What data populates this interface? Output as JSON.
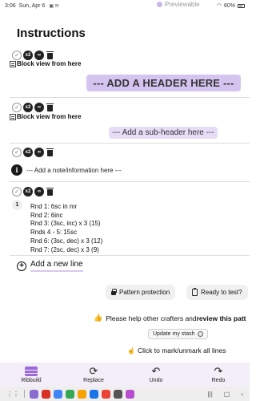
{
  "status_bar": {
    "time": "3:06",
    "date": "Sun, Apr 6",
    "battery": "60%"
  },
  "preview_link": "Previewable",
  "page_title": "Instructions",
  "blocks": [
    {
      "block_view": "Block view from here",
      "header": "--- ADD A HEADER HERE ---"
    },
    {
      "block_view": "Block view from here",
      "subheader": "--- Add a sub-header here ---"
    },
    {
      "note": "--- Add a note/information here ---"
    },
    {
      "row_number": "1",
      "rows": [
        "Rnd 1: 6sc in mr",
        "Rnd 2: 6inc",
        "Rnd 3: (3sc, inc) x 3 (15)",
        "Rnds 4 - 5: 15sc",
        "Rnd 6: (3sc, dec) x 3 (12)",
        "Rnd 7: (2sc, dec) x 3 (9)"
      ]
    }
  ],
  "tool_labels": {
    "duplicate": "x2",
    "check": "✓"
  },
  "add_line": "Add a new line",
  "buttons": {
    "pattern_protection": "Pattern protection",
    "ready_to_test": "Ready to test?",
    "update_stash": "Update my stash"
  },
  "review": {
    "prefix": "Please help other crafters and ",
    "link": "review this patt"
  },
  "mark_all": "Click to mark/unmark all lines",
  "bottom_nav": [
    {
      "label": "Ribbuild",
      "icon": "brick-icon"
    },
    {
      "label": "Replace",
      "icon": "replace-icon",
      "glyph": "⟳"
    },
    {
      "label": "Undo",
      "icon": "undo-icon",
      "glyph": "↶"
    },
    {
      "label": "Redo",
      "icon": "redo-icon",
      "glyph": "↷"
    }
  ],
  "taskbar_apps": [
    "#8a6bd1",
    "#d93025",
    "#4285f4",
    "#34a853",
    "#f4a300",
    "#1a73e8",
    "#ea4335",
    "#555555",
    "#b84dd1"
  ],
  "colors": {
    "accent_purple": "#d4c4ef",
    "nav_background": "#f4eef9"
  }
}
